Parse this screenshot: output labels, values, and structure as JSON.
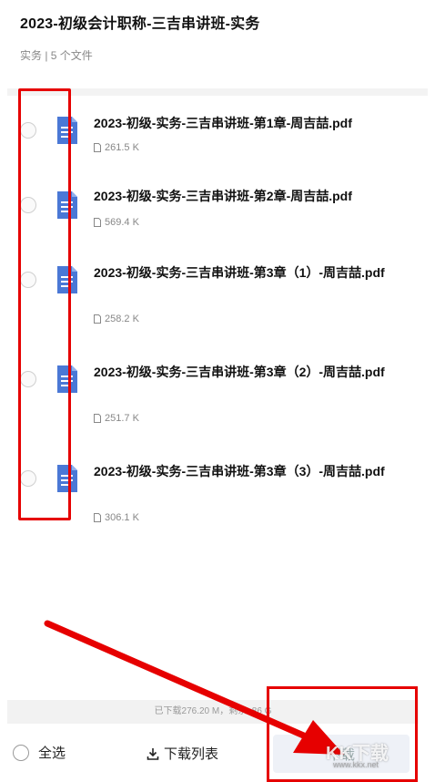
{
  "header": {
    "title": "2023-初级会计职称-三吉串讲班-实务",
    "meta": "实务 | 5 个文件"
  },
  "files": [
    {
      "name": "2023-初级-实务-三吉串讲班-第1章-周吉喆.pdf",
      "size": "261.5 K",
      "icon": "pdf-document-icon"
    },
    {
      "name": "2023-初级-实务-三吉串讲班-第2章-周吉喆.pdf",
      "size": "569.4 K",
      "icon": "pdf-document-icon"
    },
    {
      "name": "2023-初级-实务-三吉串讲班-第3章（1）-周吉喆.pdf",
      "size": "258.2 K",
      "icon": "pdf-document-icon"
    },
    {
      "name": "2023-初级-实务-三吉串讲班-第3章（2）-周吉喆.pdf",
      "size": "251.7 K",
      "icon": "pdf-document-icon"
    },
    {
      "name": "2023-初级-实务-三吉串讲班-第3章（3）-周吉喆.pdf",
      "size": "306.1 K",
      "icon": "pdf-document-icon"
    }
  ],
  "status": {
    "text": "已下载276.20 M，剩余 .86 G"
  },
  "footer": {
    "select_all_label": "全选",
    "download_list_label": "下载列表",
    "download_button_label": "下载"
  },
  "watermark": {
    "text": "KK下载",
    "url": "www.kkx.net"
  },
  "colors": {
    "annotation_red": "#e60000",
    "file_icon_blue": "#4a78d6"
  }
}
